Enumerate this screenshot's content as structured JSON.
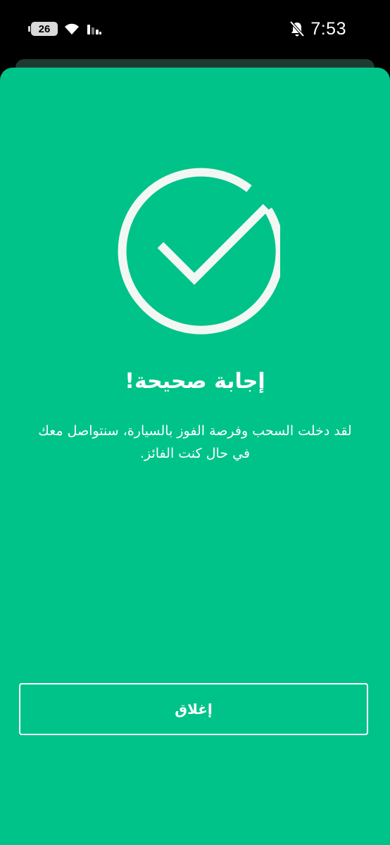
{
  "status_bar": {
    "battery_level": "26",
    "time": "7:53",
    "icons": [
      "battery-icon",
      "wifi-icon",
      "signal-icon",
      "bell-muted-icon"
    ]
  },
  "result": {
    "icon": "check-circle-icon",
    "title": "إجابة صحيحة!",
    "message": "لقد دخلت السحب وفرصة الفوز بالسيارة، سنتواصل معك في حال كنت الفائز."
  },
  "actions": {
    "close_label": "إغلاق"
  },
  "colors": {
    "background": "#00c389",
    "foreground": "#ffffff",
    "status_bar": "#000000"
  }
}
